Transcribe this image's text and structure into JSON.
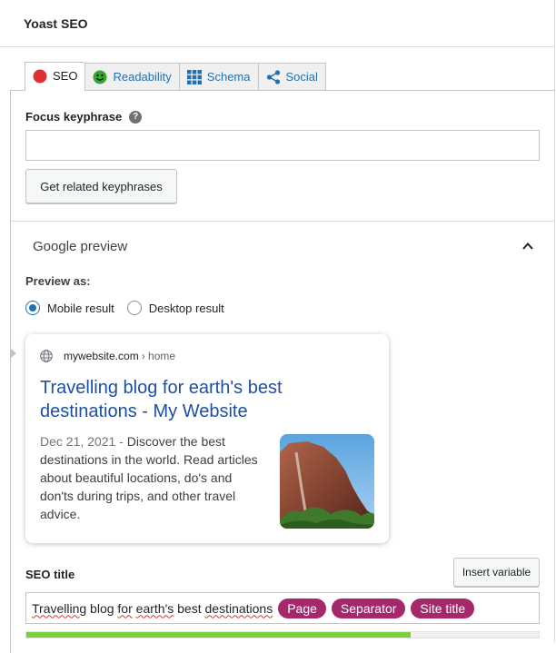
{
  "header": {
    "title": "Yoast SEO"
  },
  "tabs": [
    {
      "label": "SEO",
      "icon": "red-score-dot-icon",
      "color": "#dc3232",
      "active": true
    },
    {
      "label": "Readability",
      "icon": "green-smiley-icon",
      "color": "#7ad03a",
      "active": false
    },
    {
      "label": "Schema",
      "icon": "grid-icon",
      "color": "#2271b1",
      "active": false
    },
    {
      "label": "Social",
      "icon": "share-icon",
      "color": "#2271b1",
      "active": false
    }
  ],
  "focus": {
    "label": "Focus keyphrase",
    "help_icon": "?",
    "value": "",
    "button_label": "Get related keyphrases"
  },
  "google_preview": {
    "title": "Google preview",
    "preview_as_label": "Preview as:",
    "options": [
      {
        "label": "Mobile result",
        "checked": true
      },
      {
        "label": "Desktop result",
        "checked": false
      }
    ],
    "card": {
      "site": "mywebsite.com",
      "breadcrumb": "› home",
      "title": "Travelling blog for earth's best destinations - My Website",
      "date": "Dec 21, 2021",
      "date_sep": " - ",
      "description": "Discover the best destinations in the world. Read articles about beautiful locations, do's and don'ts during trips, and other travel advice."
    }
  },
  "seo_title": {
    "label": "SEO title",
    "insert_button": "Insert variable",
    "text_words": [
      "Travelling",
      " blog ",
      "for",
      " ",
      "earth's",
      " best ",
      "destinations"
    ],
    "variables": [
      "Page",
      "Separator",
      "Site title"
    ],
    "progress": 0.75
  },
  "colors": {
    "accent": "#2271b1",
    "pill": "#a4286a",
    "progress": "#7ad03a",
    "link": "#1f4fa3"
  }
}
